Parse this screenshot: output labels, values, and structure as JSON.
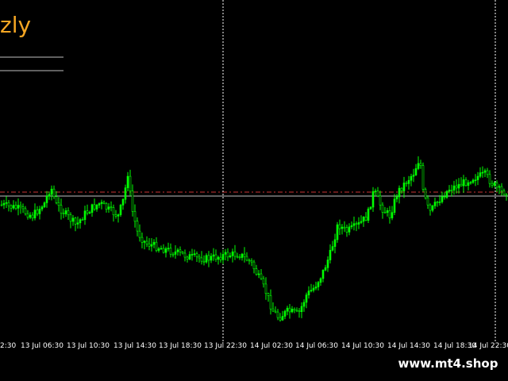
{
  "title": "zly",
  "watermark": "www.mt4.shop",
  "colors": {
    "background": "#000000",
    "candle": "#00ff00",
    "title": "#f5a623",
    "bid_line": "#c0c0c0",
    "ask_line": "#cc3333",
    "separator": "#ffffff"
  },
  "chart_data": {
    "type": "line",
    "x_tick_labels": [
      "2:30",
      "13 Jul 06:30",
      "13 Jul 10:30",
      "13 Jul 14:30",
      "13 Jul 18:30",
      "13 Jul 22:30",
      "14 Jul 02:30",
      "14 Jul 06:30",
      "14 Jul 10:30",
      "14 Jul 14:30",
      "14 Jul 18:30",
      "14 Jul 22:30"
    ],
    "separator_ticks": [
      "13 Jul 22:30",
      "14 Jul 22:30"
    ],
    "price_path": [
      [
        0,
        258
      ],
      [
        20,
        262
      ],
      [
        40,
        272
      ],
      [
        55,
        256
      ],
      [
        63,
        235
      ],
      [
        70,
        258
      ],
      [
        80,
        268
      ],
      [
        95,
        284
      ],
      [
        105,
        270
      ],
      [
        115,
        262
      ],
      [
        125,
        256
      ],
      [
        135,
        264
      ],
      [
        148,
        272
      ],
      [
        155,
        250
      ],
      [
        160,
        218
      ],
      [
        165,
        262
      ],
      [
        172,
        292
      ],
      [
        182,
        306
      ],
      [
        200,
        312
      ],
      [
        220,
        318
      ],
      [
        240,
        324
      ],
      [
        260,
        326
      ],
      [
        280,
        322
      ],
      [
        300,
        320
      ],
      [
        315,
        330
      ],
      [
        325,
        350
      ],
      [
        335,
        370
      ],
      [
        342,
        390
      ],
      [
        350,
        400
      ],
      [
        362,
        392
      ],
      [
        375,
        396
      ],
      [
        385,
        372
      ],
      [
        395,
        362
      ],
      [
        405,
        345
      ],
      [
        415,
        320
      ],
      [
        425,
        282
      ],
      [
        435,
        292
      ],
      [
        450,
        284
      ],
      [
        462,
        272
      ],
      [
        470,
        240
      ],
      [
        480,
        262
      ],
      [
        490,
        272
      ],
      [
        500,
        242
      ],
      [
        510,
        230
      ],
      [
        520,
        218
      ],
      [
        528,
        198
      ],
      [
        532,
        242
      ],
      [
        540,
        268
      ],
      [
        552,
        252
      ],
      [
        565,
        238
      ],
      [
        580,
        232
      ],
      [
        595,
        224
      ],
      [
        610,
        220
      ],
      [
        620,
        232
      ],
      [
        630,
        242
      ],
      [
        640,
        240
      ]
    ],
    "y_range": [
      180,
      420
    ],
    "grid": false
  }
}
